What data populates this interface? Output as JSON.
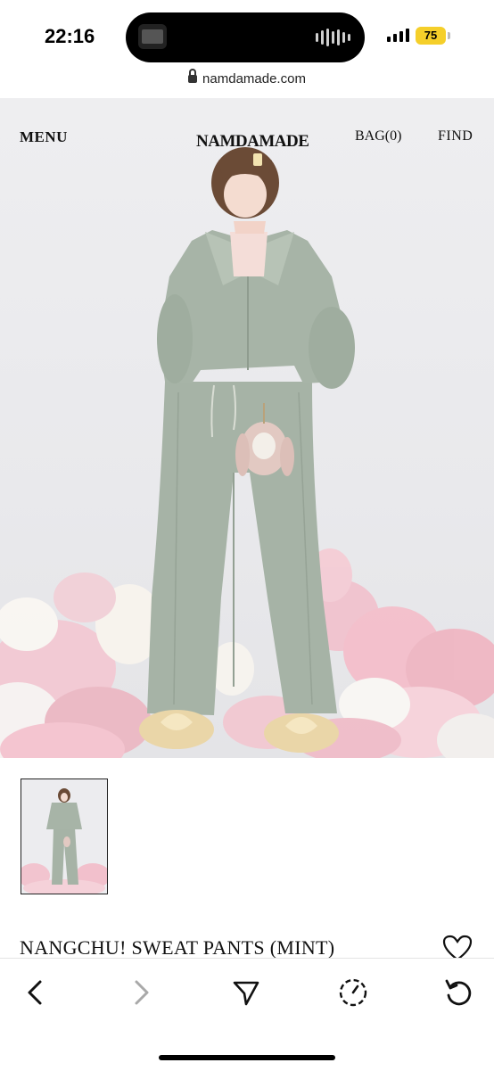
{
  "status_bar": {
    "time": "22:16",
    "battery": "75",
    "battery_color": "#f5cf2a"
  },
  "browser": {
    "url": "namdamade.com"
  },
  "site_nav": {
    "menu": "MENU",
    "logo": "NAMDAMADE",
    "bag": "BAG(0)",
    "find": "FIND"
  },
  "product": {
    "title": "NANGCHU! SWEAT PANTS (MINT)",
    "color_mint": "#a6b3a6"
  },
  "toolbar": {
    "icons": [
      "back-icon",
      "forward-icon",
      "share-icon",
      "history-icon",
      "reload-icon"
    ]
  }
}
